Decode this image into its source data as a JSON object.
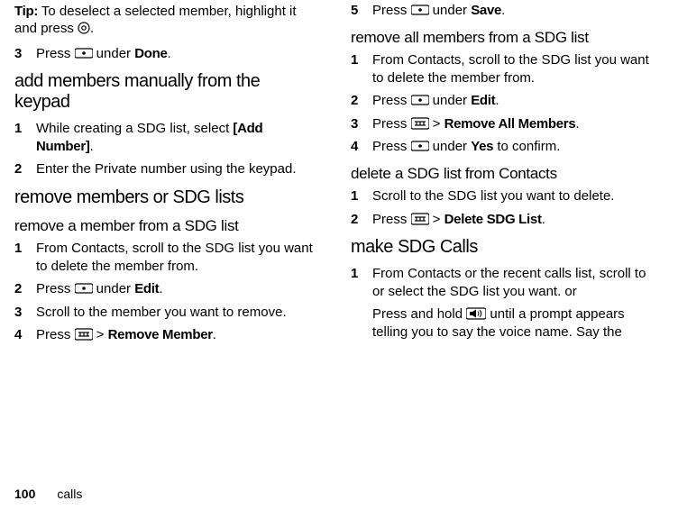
{
  "left": {
    "tip_prefix": "Tip: ",
    "tip_body": "To deselect a selected member, highlight it and press ",
    "tip_suffix": ".",
    "step3_num": "3",
    "step3_a": "Press ",
    "step3_b": " under ",
    "step3_done": "Done",
    "step3_suffix": ".",
    "h_add_members": "add members manually from the keypad",
    "s1_num": "1",
    "s1_text_a": "While creating a SDG list, select ",
    "s1_addnum": "[Add Number]",
    "s1_suffix": ".",
    "s2_num": "2",
    "s2_text": "Enter the Private number using the keypad.",
    "h_remove": "remove members or SDG lists",
    "h_remove_member": "remove a member from a SDG list",
    "r1_num": "1",
    "r1_text": "From Contacts, scroll to the SDG list you want to delete the member from.",
    "r2_num": "2",
    "r2_a": "Press ",
    "r2_b": " under ",
    "r2_edit": "Edit",
    "r2_suffix": ".",
    "r3_num": "3",
    "r3_text": "Scroll to the member you want to remove.",
    "r4_num": "4",
    "r4_a": "Press ",
    "r4_gt": " > ",
    "r4_rm": "Remove Member",
    "r4_suffix": "."
  },
  "right": {
    "p5_num": "5",
    "p5_a": "Press ",
    "p5_b": " under ",
    "p5_save": "Save",
    "p5_suffix": ".",
    "h_remove_all": "remove all members from a SDG list",
    "a1_num": "1",
    "a1_text": "From Contacts, scroll to the SDG list you want to delete the member from.",
    "a2_num": "2",
    "a2_a": "Press ",
    "a2_b": " under ",
    "a2_edit": "Edit",
    "a2_suffix": ".",
    "a3_num": "3",
    "a3_a": "Press ",
    "a3_gt": " > ",
    "a3_rm": "Remove All Members",
    "a3_suffix": ".",
    "a4_num": "4",
    "a4_a": "Press ",
    "a4_b": " under ",
    "a4_yes": "Yes",
    "a4_c": " to confirm.",
    "h_delete": "delete a SDG list from Contacts",
    "d1_num": "1",
    "d1_text": "Scroll to the SDG list you want to delete.",
    "d2_num": "2",
    "d2_a": "Press ",
    "d2_gt": " > ",
    "d2_dsl": "Delete SDG List",
    "d2_suffix": ".",
    "h_make": "make SDG Calls",
    "m1_num": "1",
    "m1_text": "From Contacts or the recent calls list, scroll to or select the SDG list you want. or",
    "m2_a": "Press and hold ",
    "m2_b": " until a prompt appears telling you to say the voice name. Say the"
  },
  "footer": {
    "page": "100",
    "section": "calls"
  }
}
